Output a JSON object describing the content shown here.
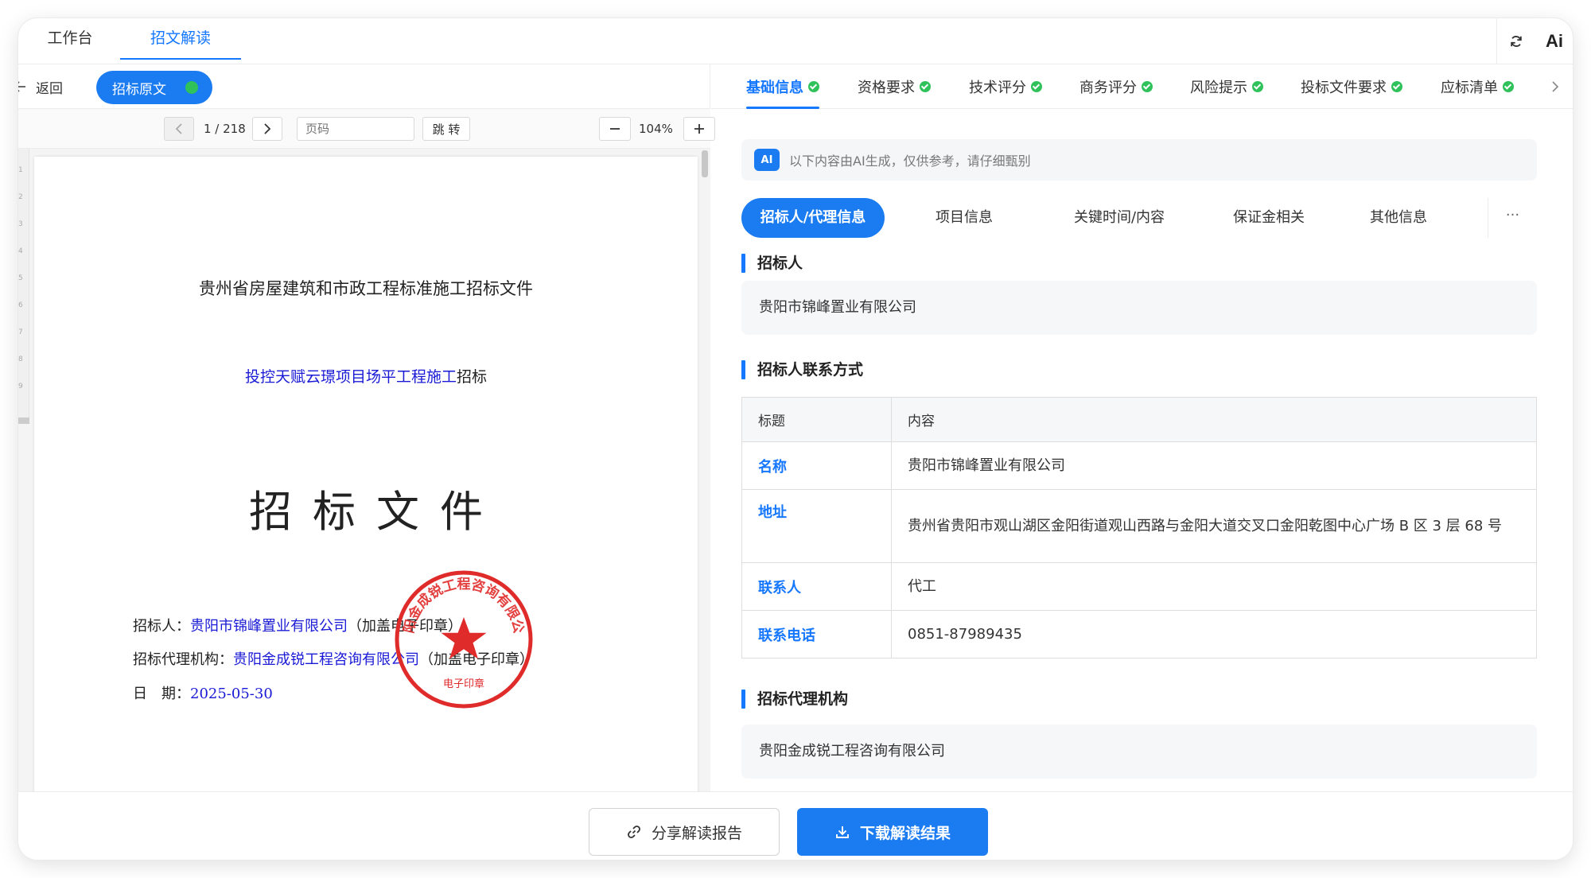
{
  "top_tabs": [
    "工作台",
    "招文解读"
  ],
  "top_right": {
    "ai_label": "Ai"
  },
  "left_nav": {
    "back_label": "返回",
    "orig_label": "招标原文"
  },
  "pdf_toolbar": {
    "page_indicator": "1 / 218",
    "page_placeholder": "页码",
    "jump_label": "跳 转",
    "zoom": "104%"
  },
  "document": {
    "heading1": "贵州省房屋建筑和市政工程标准施工招标文件",
    "heading2_blue": "投控天赋云璟项目场平工程施工",
    "heading2_black": "招标",
    "heading3": "招标文件",
    "line1_label": "招标人：",
    "line1_value": "贵阳市锦峰置业有限公司",
    "line1_note": "（加盖电子印章）",
    "line2_label": "招标代理机构：",
    "line2_value": "贵阳金成锐工程咨询有限公司",
    "line2_note": "（加盖电子印章）",
    "line3_label": "日　期：",
    "line3_value": "2025-05-30",
    "ruler_marks": [
      "1",
      "2",
      "3",
      "4",
      "5",
      "6",
      "7",
      "8",
      "9"
    ],
    "seal": {
      "ring_text": "贵阳金成锐工程咨询有限公司",
      "bottom_text": "电子印章",
      "color": "#e02b2b"
    }
  },
  "section_tabs": [
    {
      "label": "基础信息",
      "active": true
    },
    {
      "label": "资格要求",
      "active": false
    },
    {
      "label": "技术评分",
      "active": false
    },
    {
      "label": "商务评分",
      "active": false
    },
    {
      "label": "风险提示",
      "active": false
    },
    {
      "label": "投标文件要求",
      "active": false
    },
    {
      "label": "应标清单",
      "active": false
    }
  ],
  "ai_notice": {
    "badge": "AI",
    "text": "以下内容由AI生成，仅供参考，请仔细甄别"
  },
  "sub_tabs": [
    "招标人/代理信息",
    "项目信息",
    "关键时间/内容",
    "保证金相关",
    "其他信息"
  ],
  "sub_tabs_more": "···",
  "content": {
    "tenderer_title": "招标人",
    "tenderer_name": "贵阳市锦峰置业有限公司",
    "contact_title": "招标人联系方式",
    "table": {
      "headers": [
        "标题",
        "内容"
      ],
      "rows": [
        {
          "key": "名称",
          "value": "贵阳市锦峰置业有限公司"
        },
        {
          "key": "地址",
          "value": "贵州省贵阳市观山湖区金阳街道观山西路与金阳大道交叉口金阳乾图中心广场 B 区 3 层 68 号"
        },
        {
          "key": "联系人",
          "value": "代工"
        },
        {
          "key": "联系电话",
          "value": "0851-87989435"
        }
      ]
    },
    "agency_title": "招标代理机构",
    "agency_name": "贵阳金成锐工程咨询有限公司"
  },
  "bottom": {
    "share_label": "分享解读报告",
    "download_label": "下载解读结果"
  },
  "colors": {
    "accent": "#1677ff",
    "check": "#2fc25b",
    "seal": "#e02b2b"
  }
}
